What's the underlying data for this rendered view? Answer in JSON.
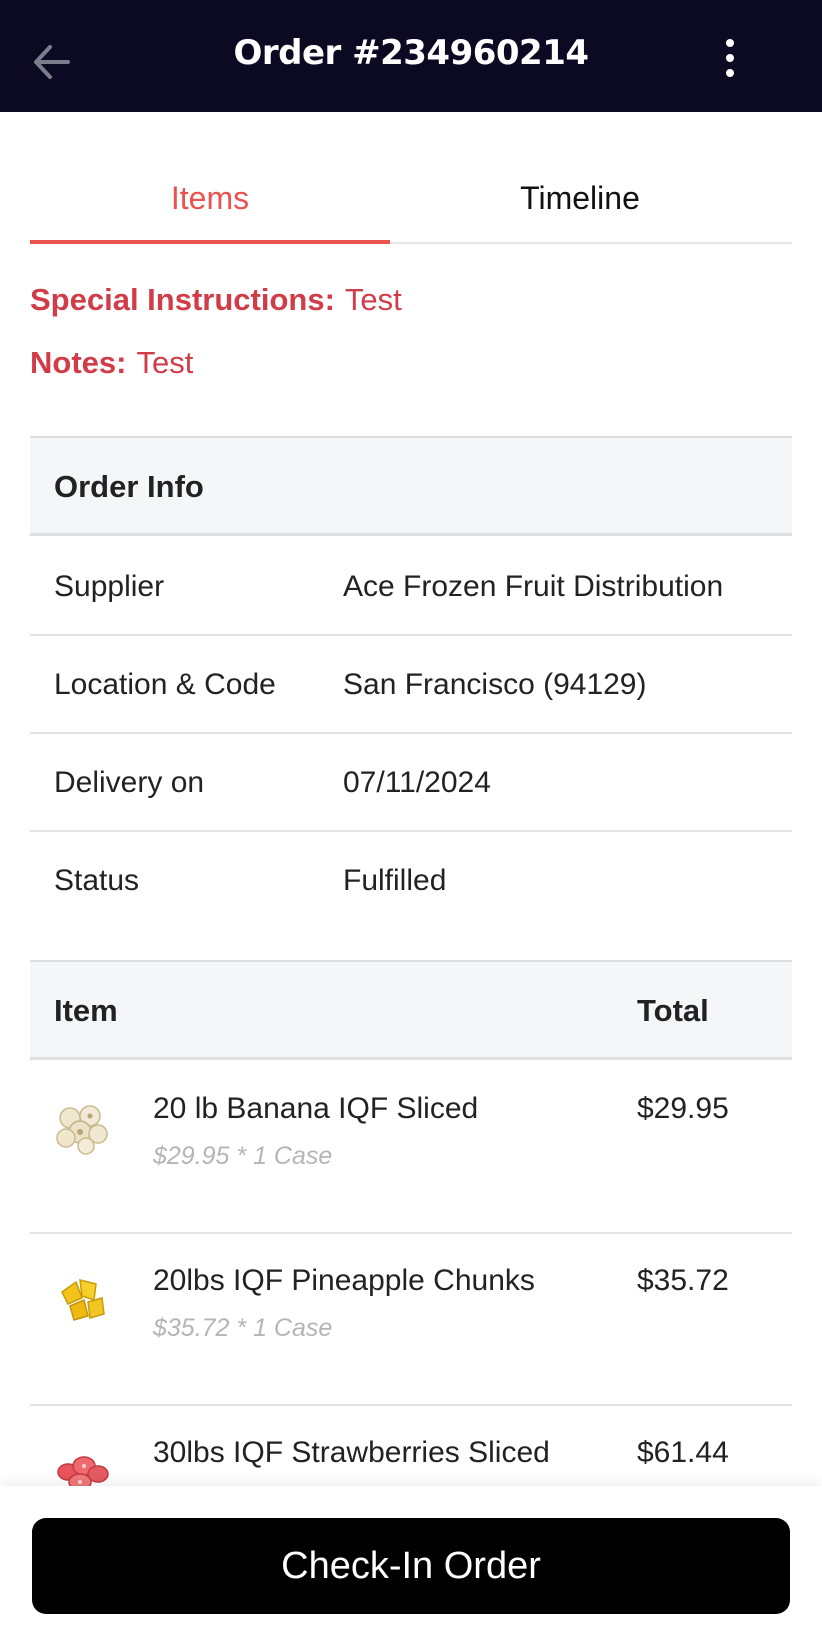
{
  "header": {
    "title": "Order #234960214",
    "back_icon": "arrow-left-icon",
    "more_icon": "more-vertical-icon"
  },
  "tabs": [
    {
      "label": "Items",
      "active": true
    },
    {
      "label": "Timeline",
      "active": false
    }
  ],
  "notes": {
    "special_instructions_label": "Special Instructions:",
    "special_instructions_value": "Test",
    "notes_label": "Notes:",
    "notes_value": "Test"
  },
  "order_info": {
    "heading": "Order Info",
    "rows": [
      {
        "label": "Supplier",
        "value": "Ace Frozen Fruit Distribution"
      },
      {
        "label": "Location & Code",
        "value": "San Francisco (94129)"
      },
      {
        "label": "Delivery on",
        "value": "07/11/2024"
      },
      {
        "label": "Status",
        "value": "Fulfilled"
      }
    ]
  },
  "items_table": {
    "col_item": "Item",
    "col_total": "Total",
    "rows": [
      {
        "name": "20 lb Banana IQF Sliced",
        "detail": "$29.95 * 1 Case",
        "total": "$29.95",
        "icon": "banana-slices-icon"
      },
      {
        "name": "20lbs IQF Pineapple Chunks",
        "detail": "$35.72 * 1 Case",
        "total": "$35.72",
        "icon": "pineapple-chunks-icon"
      },
      {
        "name": "30lbs IQF Strawberries Sliced",
        "detail": "",
        "total": "$61.44",
        "icon": "strawberry-slices-icon"
      }
    ]
  },
  "footer": {
    "checkin_label": "Check-In Order"
  },
  "colors": {
    "header_bg": "#0c0a22",
    "accent": "#ea5450",
    "notes_text": "#d13c49",
    "button_bg": "#000000"
  }
}
